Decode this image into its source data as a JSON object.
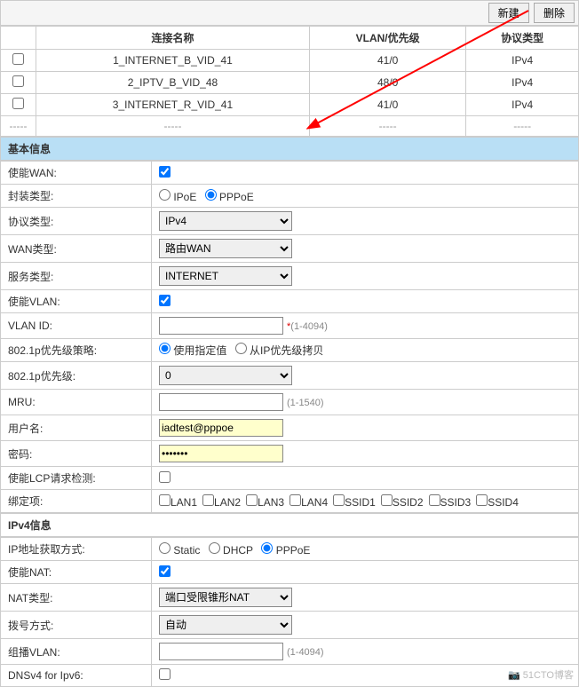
{
  "topbar": {
    "new_label": "新建",
    "delete_label": "删除"
  },
  "table": {
    "headers": {
      "name": "连接名称",
      "vlan": "VLAN/优先级",
      "proto": "协议类型"
    },
    "rows": [
      {
        "name": "1_INTERNET_B_VID_41",
        "vlan": "41/0",
        "proto": "IPv4"
      },
      {
        "name": "2_IPTV_B_VID_48",
        "vlan": "48/0",
        "proto": "IPv4"
      },
      {
        "name": "3_INTERNET_R_VID_41",
        "vlan": "41/0",
        "proto": "IPv4"
      }
    ],
    "sep": "-----"
  },
  "sections": {
    "basic": "基本信息",
    "ipv4": "IPv4信息"
  },
  "form": {
    "enable_wan": {
      "label": "使能WAN:",
      "checked": true
    },
    "encap": {
      "label": "封装类型:",
      "options": [
        "IPoE",
        "PPPoE"
      ],
      "selected": "PPPoE"
    },
    "proto_type": {
      "label": "协议类型:",
      "value": "IPv4"
    },
    "wan_type": {
      "label": "WAN类型:",
      "value": "路由WAN"
    },
    "svc_type": {
      "label": "服务类型:",
      "value": "INTERNET"
    },
    "enable_vlan": {
      "label": "使能VLAN:",
      "checked": true
    },
    "vlan_id": {
      "label": "VLAN ID:",
      "value": "",
      "hint": "(1-4094)"
    },
    "p8021": {
      "label": "802.1p优先级策略:",
      "options": [
        "使用指定值",
        "从IP优先级拷贝"
      ],
      "selected": "使用指定值"
    },
    "p8021prio": {
      "label": "802.1p优先级:",
      "value": "0"
    },
    "mru": {
      "label": "MRU:",
      "value": "",
      "hint": "(1-1540)"
    },
    "user": {
      "label": "用户名:",
      "value": "iadtest@pppoe"
    },
    "pass": {
      "label": "密码:",
      "value": "●●●●●●●"
    },
    "lcp": {
      "label": "使能LCP请求检测:",
      "checked": false
    },
    "bind": {
      "label": "绑定项:",
      "items": [
        "LAN1",
        "LAN2",
        "LAN3",
        "LAN4",
        "SSID1",
        "SSID2",
        "SSID3",
        "SSID4"
      ]
    },
    "ipmode": {
      "label": "IP地址获取方式:",
      "options": [
        "Static",
        "DHCP",
        "PPPoE"
      ],
      "selected": "PPPoE"
    },
    "nat_en": {
      "label": "使能NAT:",
      "checked": true
    },
    "nat_type": {
      "label": "NAT类型:",
      "value": "端口受限锥形NAT"
    },
    "dial": {
      "label": "拨号方式:",
      "value": "自动"
    },
    "mcast": {
      "label": "组播VLAN:",
      "value": "",
      "hint": "(1-4094)"
    },
    "dnsv4": {
      "label": "DNSv4 for Ipv6:",
      "checked": false
    }
  },
  "watermark": "51CTO博客"
}
